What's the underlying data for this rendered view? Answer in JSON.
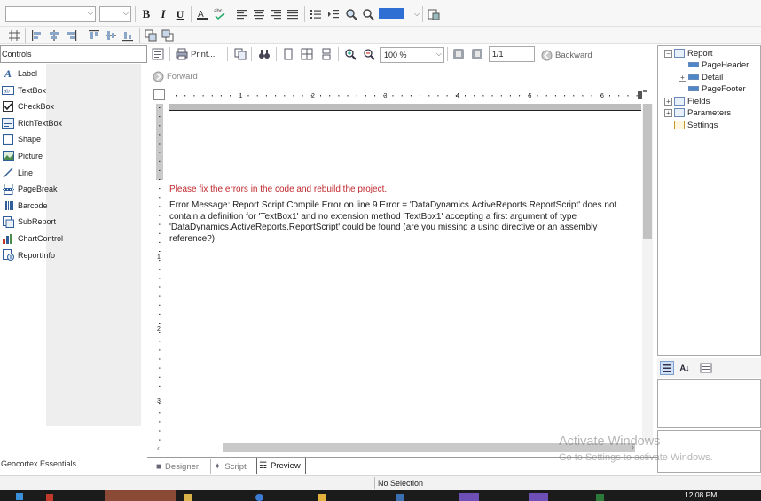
{
  "toolbar_format": {
    "font_name_value": "",
    "font_size_value": "",
    "bold_label": "B",
    "italic_label": "I",
    "underline_label": "U"
  },
  "controls_panel": {
    "header": "Controls",
    "items": [
      {
        "label": "Label",
        "icon": "label-icon"
      },
      {
        "label": "TextBox",
        "icon": "textbox-icon"
      },
      {
        "label": "CheckBox",
        "icon": "checkbox-icon"
      },
      {
        "label": "RichTextBox",
        "icon": "richtextbox-icon"
      },
      {
        "label": "Shape",
        "icon": "shape-icon"
      },
      {
        "label": "Picture",
        "icon": "picture-icon"
      },
      {
        "label": "Line",
        "icon": "line-icon"
      },
      {
        "label": "PageBreak",
        "icon": "pagebreak-icon"
      },
      {
        "label": "Barcode",
        "icon": "barcode-icon"
      },
      {
        "label": "SubReport",
        "icon": "subreport-icon"
      },
      {
        "label": "ChartControl",
        "icon": "chart-icon"
      },
      {
        "label": "ReportInfo",
        "icon": "reportinfo-icon"
      }
    ],
    "footer_group": "Geocortex Essentials"
  },
  "preview_toolbar": {
    "print_label": "Print...",
    "zoom_value": "100 %",
    "page_value": "1/1",
    "backward_label": "Backward",
    "forward_label": "Forward"
  },
  "ruler": {
    "marks": [
      "1",
      "2",
      "3",
      "4",
      "5",
      "6"
    ]
  },
  "vertical_ruler": {
    "marks": [
      "1",
      "2",
      "3"
    ]
  },
  "preview": {
    "error_title": "Please fix the errors in the code and rebuild the project.",
    "error_message": "Error Message: Report Script Compile Error on line 9 Error = 'DataDynamics.ActiveReports.ReportScript' does not contain a definition for 'TextBox1' and no extension method 'TextBox1' accepting a first argument of type 'DataDynamics.ActiveReports.ReportScript' could be found (are you missing a using directive or an assembly reference?)"
  },
  "report_tree": {
    "root": "Report",
    "sections": [
      "PageHeader",
      "Detail",
      "PageFooter"
    ],
    "others": [
      "Fields",
      "Parameters",
      "Settings"
    ]
  },
  "tabs": {
    "designer": "Designer",
    "script": "Script",
    "preview": "Preview"
  },
  "status_bar": {
    "selection": "No Selection"
  },
  "watermark": {
    "title": "Activate Windows",
    "subtitle": "Go to Settings to activate Windows."
  },
  "taskbar": {
    "clock": "12:08 PM"
  },
  "colors": {
    "error_red": "#c0282d",
    "toolbar_bg": "#f5f6f7",
    "panel_gray": "#eeeeee",
    "taskbar": "#1b1b1b"
  }
}
